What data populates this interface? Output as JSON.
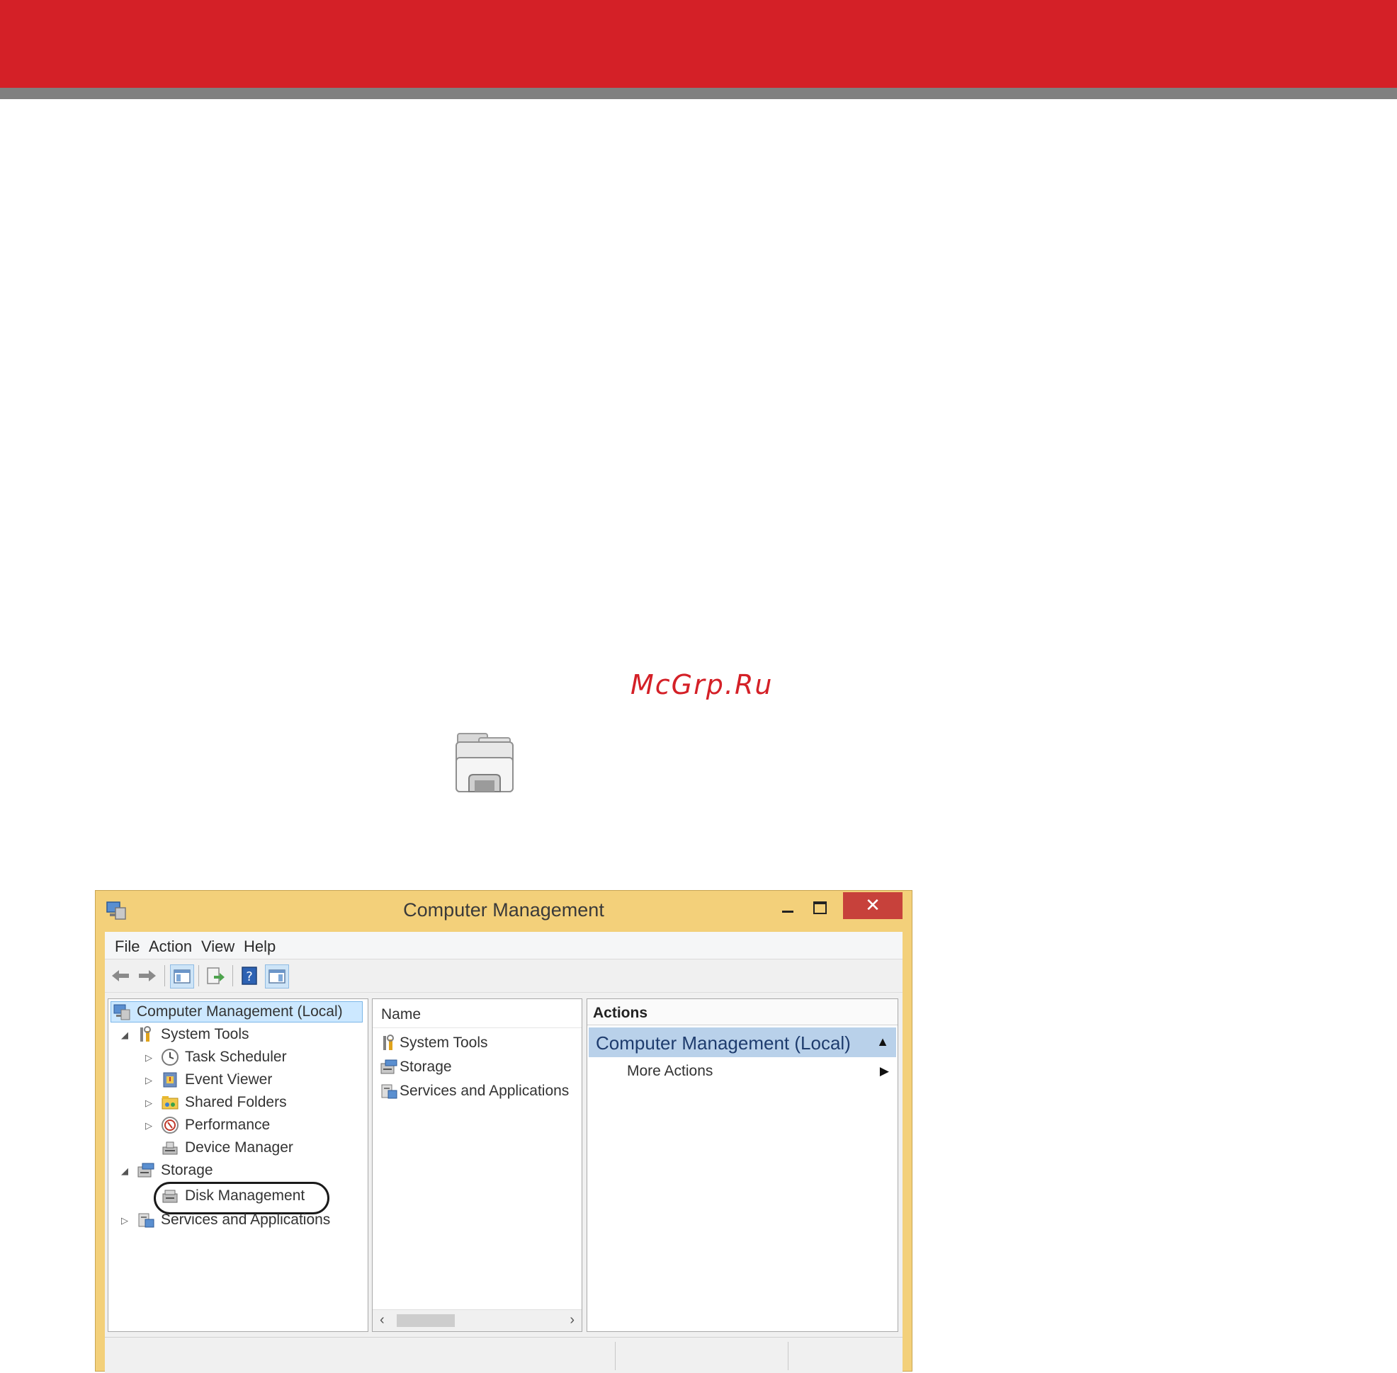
{
  "watermark": "McGrp.Ru",
  "window": {
    "title": "Computer Management",
    "close_glyph": "✕",
    "menu": [
      "File",
      "Action",
      "View",
      "Help"
    ],
    "toolbar_icons": [
      "back-icon",
      "forward-icon",
      "show-hide-console-tree-icon",
      "export-list-icon",
      "help-icon",
      "show-hide-action-pane-icon"
    ],
    "tree": {
      "root": "Computer Management (Local)",
      "items": [
        {
          "label": "System Tools",
          "icon": "system-tools-icon"
        },
        {
          "label": "Task Scheduler",
          "icon": "task-scheduler-icon"
        },
        {
          "label": "Event Viewer",
          "icon": "event-viewer-icon"
        },
        {
          "label": "Shared Folders",
          "icon": "shared-folders-icon"
        },
        {
          "label": "Performance",
          "icon": "performance-icon"
        },
        {
          "label": "Device Manager",
          "icon": "device-manager-icon"
        },
        {
          "label": "Storage",
          "icon": "storage-icon"
        },
        {
          "label": "Disk Management",
          "icon": "disk-management-icon"
        },
        {
          "label": "Services and Applications",
          "icon": "services-icon"
        }
      ]
    },
    "list": {
      "header": "Name",
      "rows": [
        "System Tools",
        "Storage",
        "Services and Applications"
      ]
    },
    "actions": {
      "header": "Actions",
      "section": "Computer Management (Local)",
      "item": "More Actions"
    }
  },
  "colors": {
    "brand_red": "#d42027",
    "window_frame": "#f3d07a",
    "close_button": "#c7413b",
    "selection": "#cce8ff"
  }
}
